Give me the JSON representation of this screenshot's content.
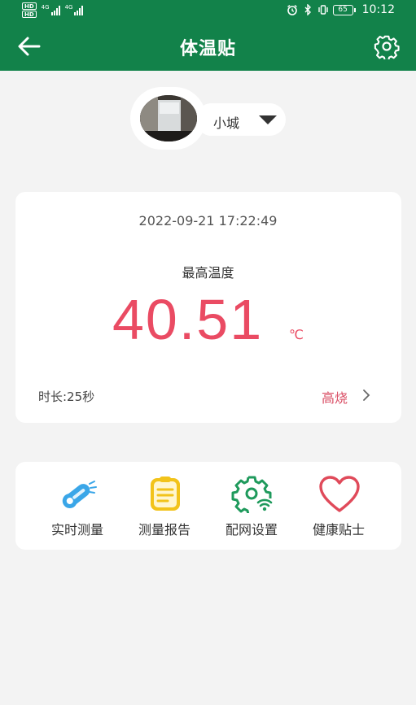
{
  "status_bar": {
    "badge_1": "HD",
    "badge_2": "HD",
    "network_1": "4G",
    "network_2": "4G",
    "battery": "65",
    "time": "10:12",
    "icons": [
      "alarm-icon",
      "bluetooth-icon",
      "vibrate-icon"
    ]
  },
  "appbar": {
    "title": "体温贴",
    "back_icon": "arrow-left-icon",
    "settings_icon": "gear-icon",
    "color": "#12824a"
  },
  "device": {
    "name": "小城",
    "dropdown_icon": "caret-down-icon"
  },
  "reading": {
    "timestamp": "2022-09-21 17:22:49",
    "label": "最高温度",
    "value": "40.51",
    "unit": "℃",
    "duration": "时长:25秒",
    "status": "高烧",
    "status_color": "#ea4b63"
  },
  "functions": [
    {
      "label": "实时测量",
      "icon": "thermometer-icon",
      "color": "#3aa6e8"
    },
    {
      "label": "测量报告",
      "icon": "clipboard-icon",
      "color": "#f2c31a"
    },
    {
      "label": "配网设置",
      "icon": "gear-wifi-icon",
      "color": "#1f9a5c"
    },
    {
      "label": "健康贴士",
      "icon": "heart-icon",
      "color": "#e04a5a"
    }
  ]
}
